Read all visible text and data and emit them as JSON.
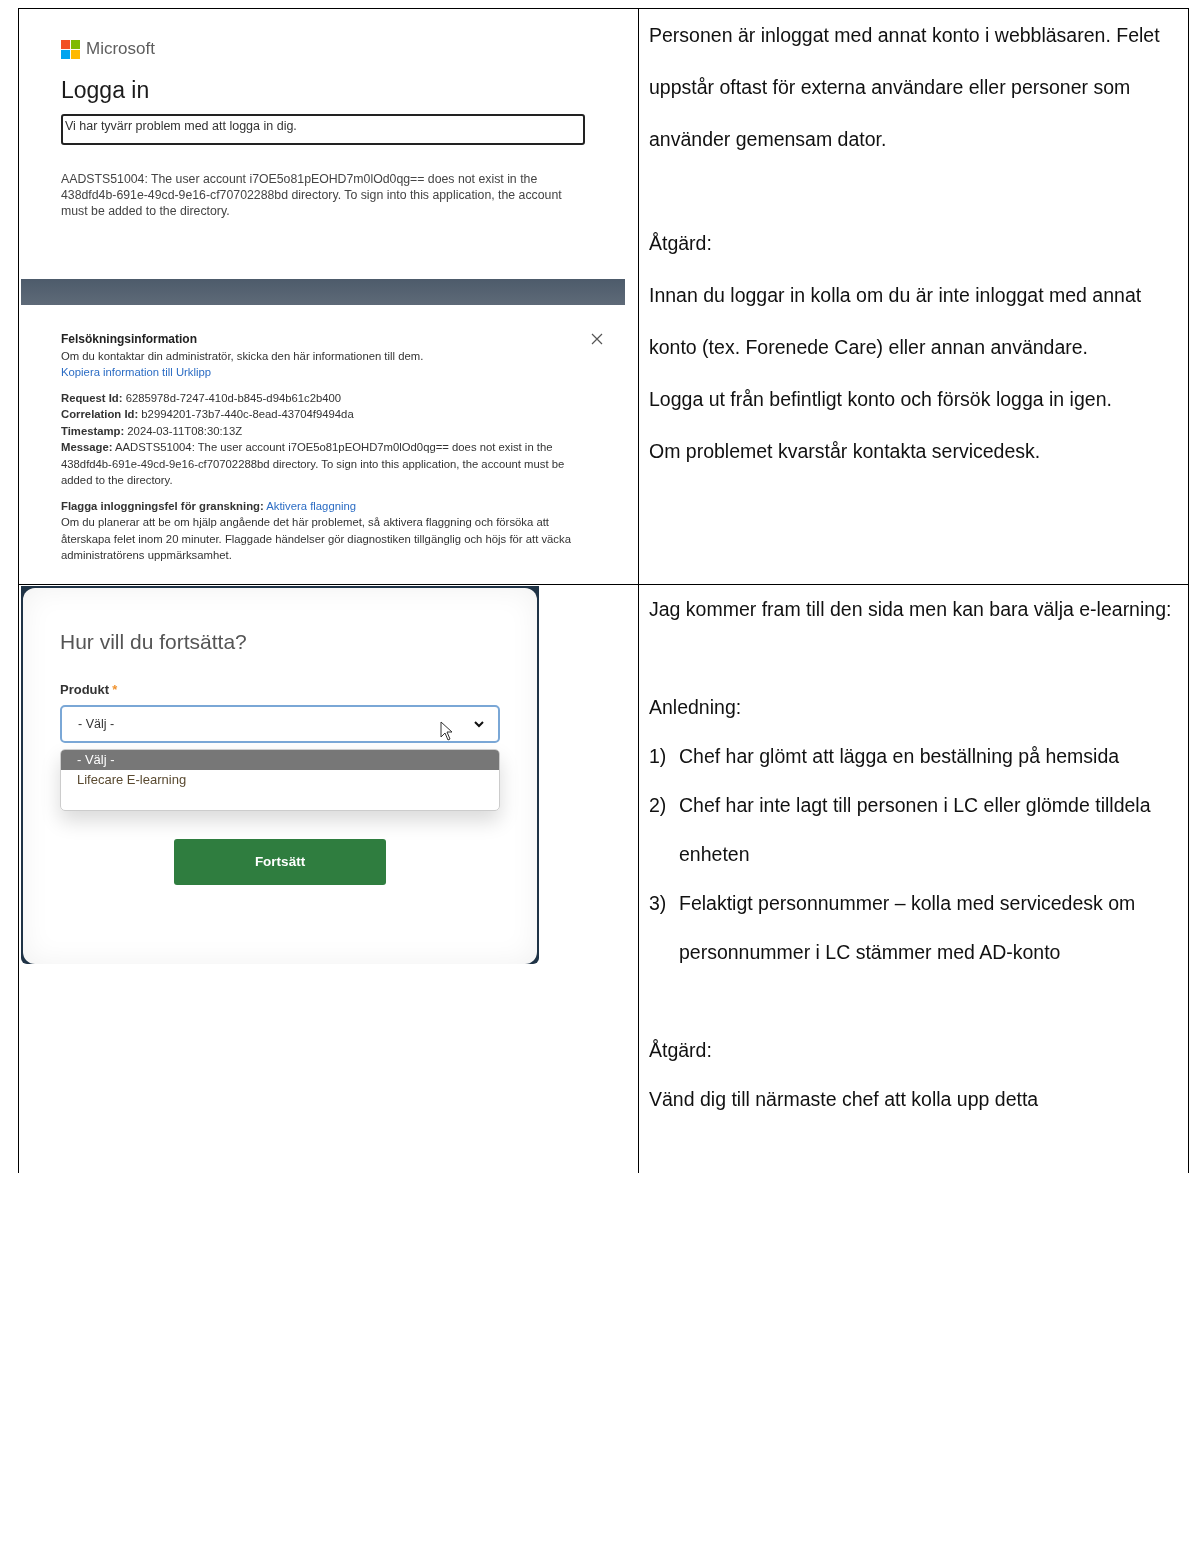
{
  "rows": [
    {
      "screenshot": {
        "kind": "signin_error",
        "brand": "Microsoft",
        "title": "Logga in",
        "alert": "Vi har tyvärr problem med att logga in dig.",
        "error": "AADSTS51004: The user account i7OE5o81pEOHD7m0lOd0qg== does not exist in the 438dfd4b-691e-49cd-9e16-cf70702288bd directory. To sign into this application, the account must be added to the directory.",
        "troubleshooting": {
          "title": "Felsökningsinformation",
          "intro": "Om du kontaktar din administratör, skicka den här informationen till dem.",
          "copy_link": "Kopiera information till Urklipp",
          "details": [
            "**Request Id:** 6285978d-7247-410d-b845-d94b61c2b400",
            "**Correlation Id:** b2994201-73b7-440c-8ead-43704f9494da",
            "**Timestamp:** 2024-03-11T08:30:13Z",
            "**Message:** AADSTS51004: The user account i7OE5o81pEOHD7m0lOd0qg== does not exist in the 438dfd4b-691e-49cd-9e16-cf70702288bd directory. To sign into this application, the account must be added to the directory."
          ],
          "flag_label": "Flagga inloggningsfel för granskning:",
          "flag_link": "Aktivera flaggning",
          "flag_text": "Om du planerar att be om hjälp angående det här problemet, så aktivera flaggning och försöka att återskapa felet inom 20 minuter. Flaggade händelser gör diagnostiken tillgänglig och höjs för att väcka administratörens uppmärksamhet."
        }
      },
      "sections": [
        [
          {
            "kind": "text",
            "text": "Personen är inloggat med annat konto i webbläsaren. Felet uppstår oftast för externa användare eller personer som använder gemensam dator."
          }
        ],
        [
          {
            "kind": "text",
            "text": "Åtgärd:"
          },
          {
            "kind": "text",
            "text": "Innan du loggar in kolla om du är inte inloggat med annat konto (tex. Forenede Care) eller annan användare."
          },
          {
            "kind": "text",
            "text": "Logga ut från befintligt konto och försök logga in igen."
          },
          {
            "kind": "text",
            "text": "Om problemet kvarstår kontakta servicedesk."
          }
        ]
      ]
    },
    {
      "screenshot": {
        "kind": "product_form",
        "title": "Hur vill du fortsätta?",
        "label": "Produkt",
        "required": "*",
        "value": "- Välj -",
        "options": [
          {
            "label": "- Välj -",
            "selected": true
          },
          {
            "label": "Lifecare E-learning",
            "selected": false
          }
        ],
        "button": "Fortsätt"
      },
      "sections": [
        [
          {
            "kind": "text",
            "text": "Jag kommer fram till den sida men kan bara välja e-learning:"
          }
        ],
        [
          {
            "kind": "text",
            "text": "Anledning:"
          },
          {
            "kind": "item",
            "number": "1)",
            "text": "Chef har glömt att lägga en beställning på hemsida"
          },
          {
            "kind": "item",
            "number": "2)",
            "text": "Chef har inte lagt till personen i LC eller glömde tilldela enheten"
          },
          {
            "kind": "item",
            "number": "3)",
            "text": "Felaktigt personnummer – kolla med servicedesk om personnummer i LC stämmer med AD-konto"
          }
        ],
        [
          {
            "kind": "text",
            "text": "Åtgärd:"
          },
          {
            "kind": "text",
            "text": "Vänd dig till närmaste chef att kolla upp detta"
          }
        ]
      ]
    }
  ]
}
